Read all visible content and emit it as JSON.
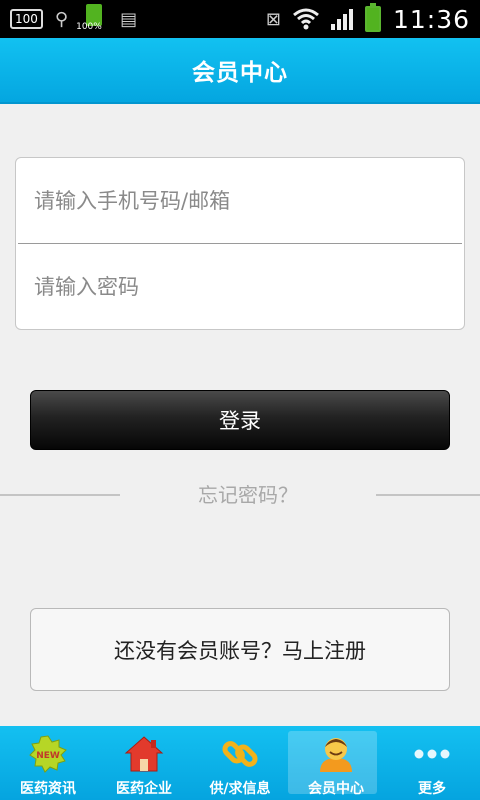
{
  "status_bar": {
    "left_badge": "100",
    "battery_percent": "100%",
    "time": "11:36"
  },
  "header": {
    "title": "会员中心"
  },
  "login_form": {
    "account_placeholder": "请输入手机号码/邮箱",
    "password_placeholder": "请输入密码",
    "login_label": "登录",
    "forgot_label": "忘记密码？"
  },
  "register": {
    "label": "还没有会员账号？马上注册"
  },
  "bottom_nav": {
    "items": [
      {
        "label": "医药资讯",
        "icon": "news-new-badge-icon"
      },
      {
        "label": "医药企业",
        "icon": "house-icon"
      },
      {
        "label": "供/求信息",
        "icon": "chain-link-icon"
      },
      {
        "label": "会员中心",
        "icon": "user-avatar-icon"
      },
      {
        "label": "更多",
        "icon": "more-dots-icon"
      }
    ],
    "active_index": 3
  },
  "colors": {
    "accent": "#05a4df",
    "background": "#f0f0f0"
  }
}
